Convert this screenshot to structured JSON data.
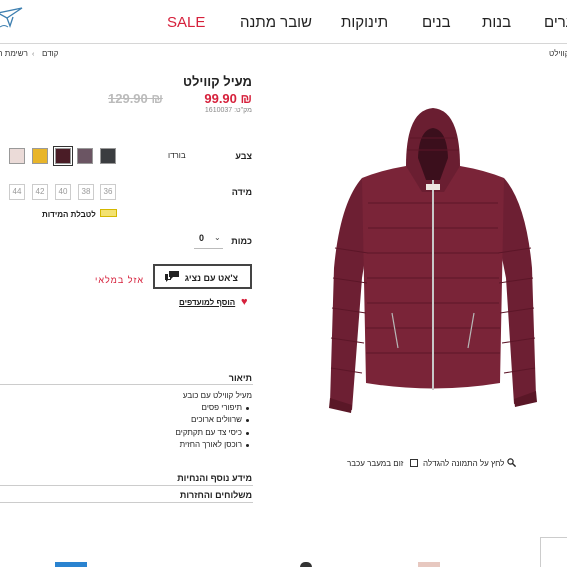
{
  "nav": {
    "items": [
      {
        "label": "SALE",
        "sale": true
      },
      {
        "label": "שובר מתנה"
      },
      {
        "label": "תינוקות"
      },
      {
        "label": "בנים"
      },
      {
        "label": "בנות"
      },
      {
        "label": "נערים"
      }
    ]
  },
  "breadcrumb": {
    "left_prev": "קודם",
    "left_list": "רשימת המ",
    "right_current": "קווילט"
  },
  "product": {
    "title": "מעיל קווילט",
    "sale_price": "99.90 ₪",
    "original_price": "129.90 ₪",
    "sku": "מק\"ט: 1610037"
  },
  "options": {
    "color_label": "צבע",
    "color_name": "בורדו",
    "swatches": [
      {
        "name": "dark-gray",
        "color": "#3b3d40"
      },
      {
        "name": "mauve",
        "color": "#6b5563"
      },
      {
        "name": "burgundy",
        "color": "#4a1c26",
        "selected": true
      },
      {
        "name": "mustard",
        "color": "#e8b52a"
      },
      {
        "name": "light-pink",
        "color": "#ebdbd8"
      }
    ],
    "size_label": "מידה",
    "sizes": [
      "36",
      "38",
      "40",
      "42",
      "44"
    ],
    "size_chart": "לטבלת המידות",
    "qty_label": "כמות",
    "qty_value": "0"
  },
  "actions": {
    "chat": "צ'אט עם נציג",
    "soldout": "אזל במלאי",
    "wishlist": "הוסף למועדפים"
  },
  "description": {
    "title": "תיאור",
    "intro": "מעיל קווילט עם כובע",
    "bullets": [
      "תיפורי פסים",
      "שרוולים ארוכים",
      "כיסי צד עם תקתקים",
      "רוכסן לאורך החזית"
    ]
  },
  "sections": {
    "more_info": "מידע נוסף והנחיות",
    "shipping": "משלוחים והחזרות"
  },
  "image": {
    "click_zoom": "לחץ על התמונה להגדלה",
    "hover_zoom": "זום במעבר עכבר"
  }
}
